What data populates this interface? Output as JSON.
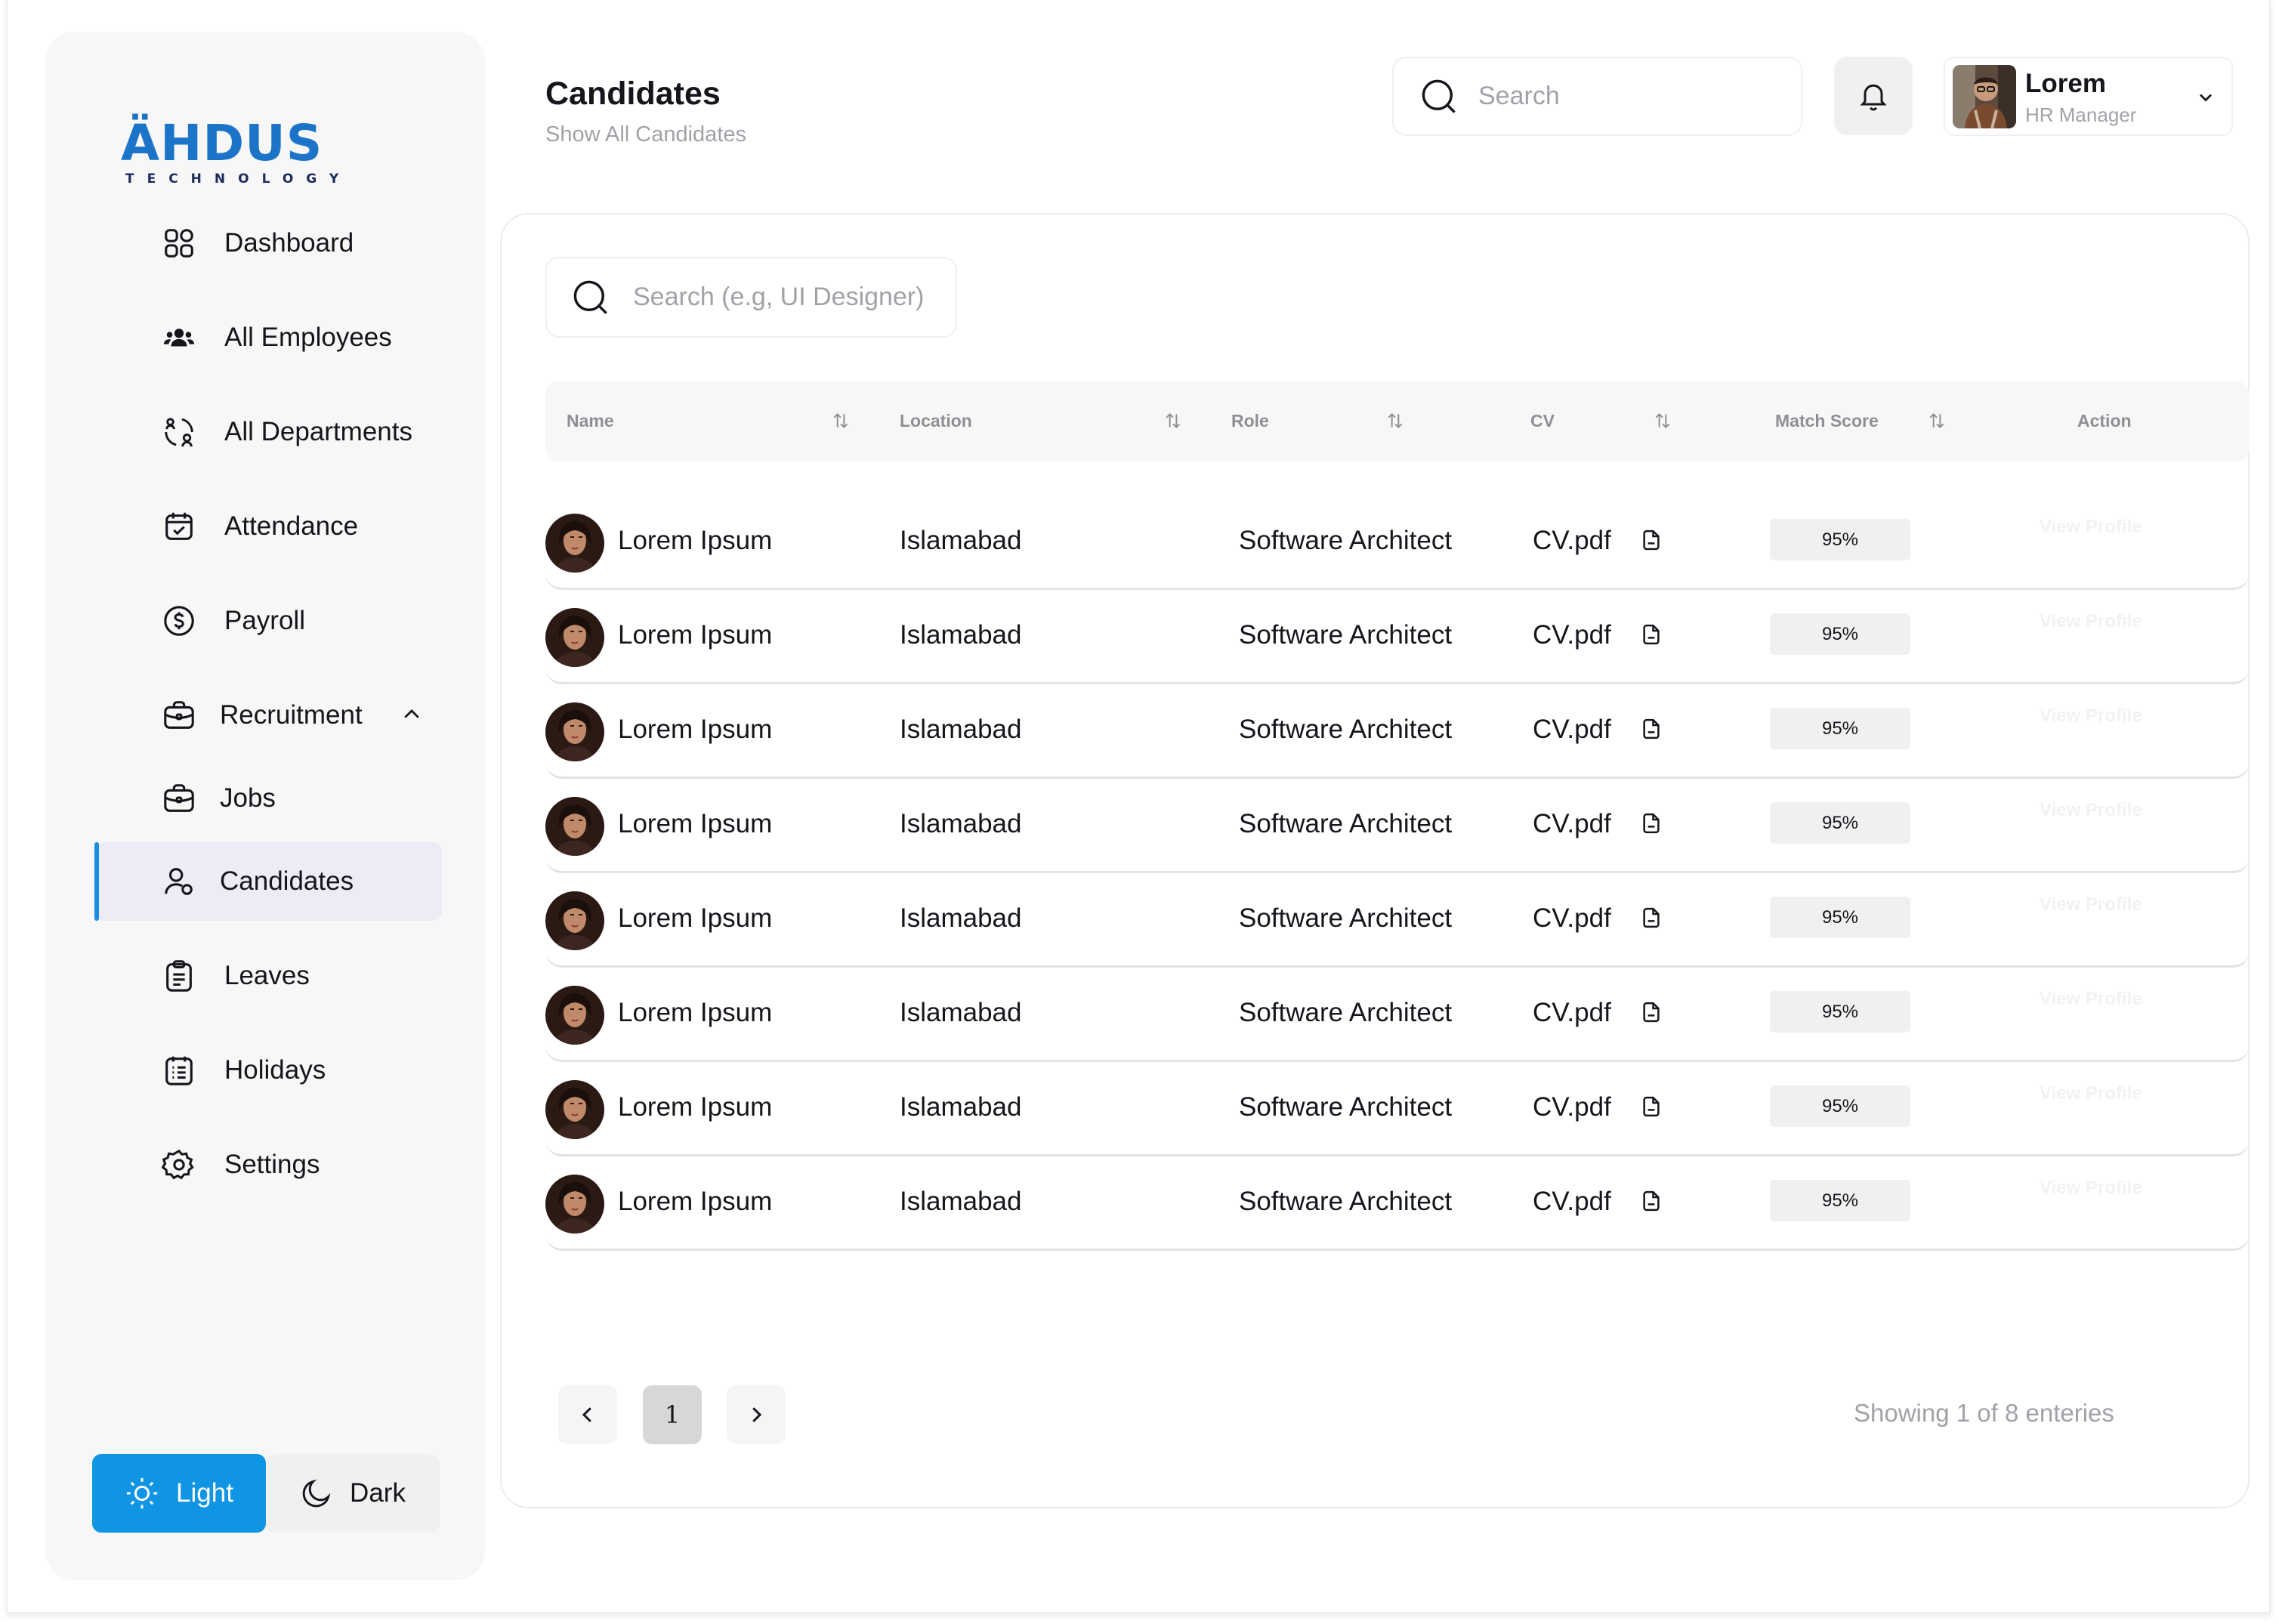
{
  "brand": {
    "name": "ÄHDUS",
    "tagline": "TECHNOLOGY"
  },
  "sidebar": {
    "items": [
      {
        "label": "Dashboard",
        "icon": "dashboard-icon"
      },
      {
        "label": "All Employees",
        "icon": "users-icon"
      },
      {
        "label": "All Departments",
        "icon": "departments-icon"
      },
      {
        "label": "Attendance",
        "icon": "calendar-check-icon"
      },
      {
        "label": "Payroll",
        "icon": "dollar-circle-icon"
      },
      {
        "label": "Recruitment",
        "icon": "briefcase-icon",
        "expanded": true
      },
      {
        "label": "Jobs",
        "icon": "briefcase-icon"
      },
      {
        "label": "Candidates",
        "icon": "user-icon",
        "active": true
      },
      {
        "label": "Leaves",
        "icon": "clipboard-icon"
      },
      {
        "label": "Holidays",
        "icon": "calendar-list-icon"
      },
      {
        "label": "Settings",
        "icon": "gear-icon"
      }
    ],
    "theme": {
      "light_label": "Light",
      "dark_label": "Dark",
      "selected": "Light"
    }
  },
  "header": {
    "title": "Candidates",
    "subtitle": "Show All Candidates",
    "search_placeholder": "Search",
    "user": {
      "name": "Lorem",
      "role": "HR Manager"
    }
  },
  "table": {
    "search_placeholder": "Search (e.g, UI Designer)",
    "columns": [
      "Name",
      "Location",
      "Role",
      "CV",
      "Match Score",
      "Action"
    ],
    "rows": [
      {
        "name": "Lorem Ipsum",
        "location": "Islamabad",
        "role": "Software Architect",
        "cv": "CV.pdf",
        "score": "95%",
        "action": "View Profile"
      },
      {
        "name": "Lorem Ipsum",
        "location": "Islamabad",
        "role": "Software Architect",
        "cv": "CV.pdf",
        "score": "95%",
        "action": "View Profile"
      },
      {
        "name": "Lorem Ipsum",
        "location": "Islamabad",
        "role": "Software Architect",
        "cv": "CV.pdf",
        "score": "95%",
        "action": "View Profile"
      },
      {
        "name": "Lorem Ipsum",
        "location": "Islamabad",
        "role": "Software Architect",
        "cv": "CV.pdf",
        "score": "95%",
        "action": "View Profile"
      },
      {
        "name": "Lorem Ipsum",
        "location": "Islamabad",
        "role": "Software Architect",
        "cv": "CV.pdf",
        "score": "95%",
        "action": "View Profile"
      },
      {
        "name": "Lorem Ipsum",
        "location": "Islamabad",
        "role": "Software Architect",
        "cv": "CV.pdf",
        "score": "95%",
        "action": "View Profile"
      },
      {
        "name": "Lorem Ipsum",
        "location": "Islamabad",
        "role": "Software Architect",
        "cv": "CV.pdf",
        "score": "95%",
        "action": "View Profile"
      },
      {
        "name": "Lorem Ipsum",
        "location": "Islamabad",
        "role": "Software Architect",
        "cv": "CV.pdf",
        "score": "95%",
        "action": "View Profile"
      }
    ]
  },
  "pagination": {
    "current_page": "1",
    "summary": "Showing 1 of 8 enteries"
  },
  "colors": {
    "accent": "#0f95e4",
    "brand": "#1c74c9",
    "active_bg": "#ebecf5"
  }
}
